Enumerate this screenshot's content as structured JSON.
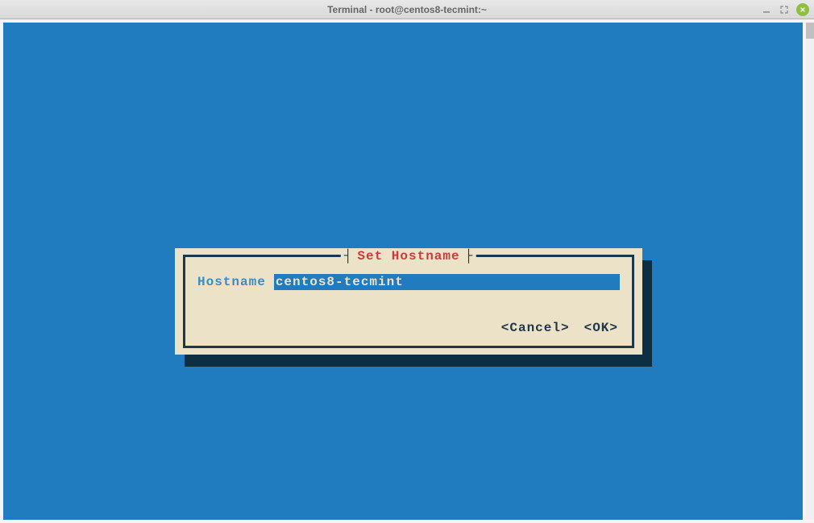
{
  "window": {
    "title": "Terminal - root@centos8-tecmint:~"
  },
  "dialog": {
    "title": "Set Hostname",
    "field_label": "Hostname",
    "field_value": "centos8-tecmint",
    "buttons": {
      "cancel": "Cancel",
      "ok": "OK"
    }
  }
}
